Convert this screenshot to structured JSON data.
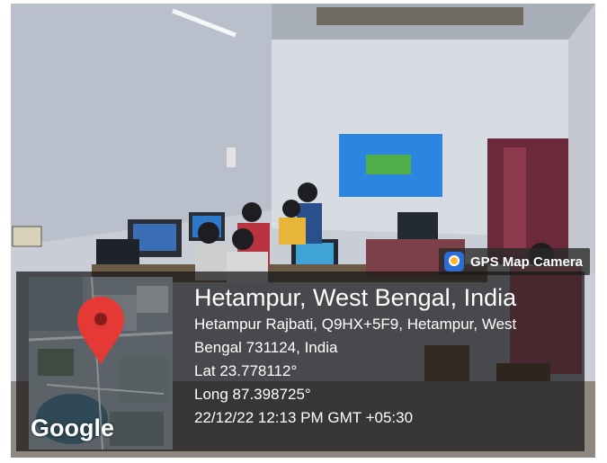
{
  "badge": {
    "icon": "gps-map-camera-app-icon",
    "label": "GPS Map Camera"
  },
  "map": {
    "pin_icon": "location-pin-icon",
    "pin_color": "#e53935",
    "logo": "Google"
  },
  "location": {
    "title": "Hetampur, West Bengal, India",
    "address_line1": "Hetampur Rajbati, Q9HX+5F9, Hetampur, West",
    "address_line2": "Bengal 731124, India",
    "lat": "Lat 23.778112°",
    "long": "Long 87.398725°",
    "timestamp": "22/12/22 12:13 PM GMT +05:30"
  }
}
